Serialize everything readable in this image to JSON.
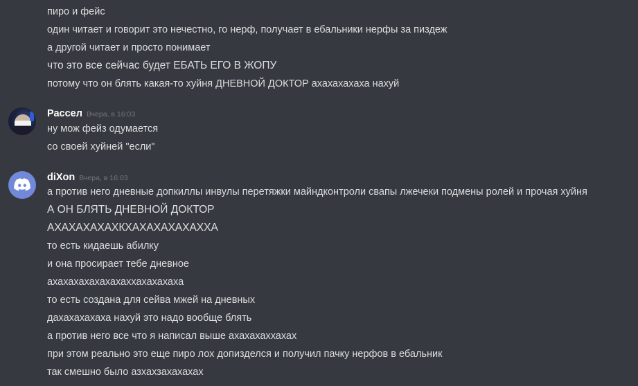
{
  "continuation_lines": [
    "пиро и фейс",
    "один читает и говорит это нечестно, го нерф, получает в ебальники нерфы за пиздеж",
    "а другой читает и просто понимает",
    "что это все сейчас будет ЕБАТЬ ЕГО В ЖОПУ",
    "потому что он блять какая-то хуйня ДНЕВНОЙ ДОКТОР ахахахахаха нахуй"
  ],
  "messages": [
    {
      "username": "Рассел",
      "timestamp": "Вчера, в 16:03",
      "lines": [
        "ну мож фейз одумается",
        "со своей хуйней \"если\""
      ]
    },
    {
      "username": "diXon",
      "timestamp": "Вчера, в 16:03",
      "lines": [
        "а против него дневные допкиллы инвулы перетяжки майндконтроли свапы лжечеки подмены ролей и прочая хуйня",
        "А ОН БЛЯТЬ ДНЕВНОЙ ДОКТОР",
        "АХАХАХАХАХКХАХАХАХАХАХХА",
        "то есть кидаешь абилку",
        "и она просирает тебе дневное",
        "ахахахахахахахаххахахахаха",
        "то есть создана для сейва мжей на дневных",
        "дахахахахаха нахуй это надо вообще блять",
        "а против него все что я написал выше ахахахаххахах",
        "при этом реально это еще пиро лох допизделся и получил пачку нерфов в ебальник",
        "так смешно было азхахзахахахах"
      ]
    }
  ],
  "colors": {
    "background": "#36393f",
    "text": "#dcddde",
    "username": "#ffffff",
    "timestamp": "#72767d",
    "discord_blurple": "#7289da"
  },
  "icons": {
    "russel_avatar": "user-photo-avatar",
    "dixon_avatar": "discord-logo-avatar"
  }
}
